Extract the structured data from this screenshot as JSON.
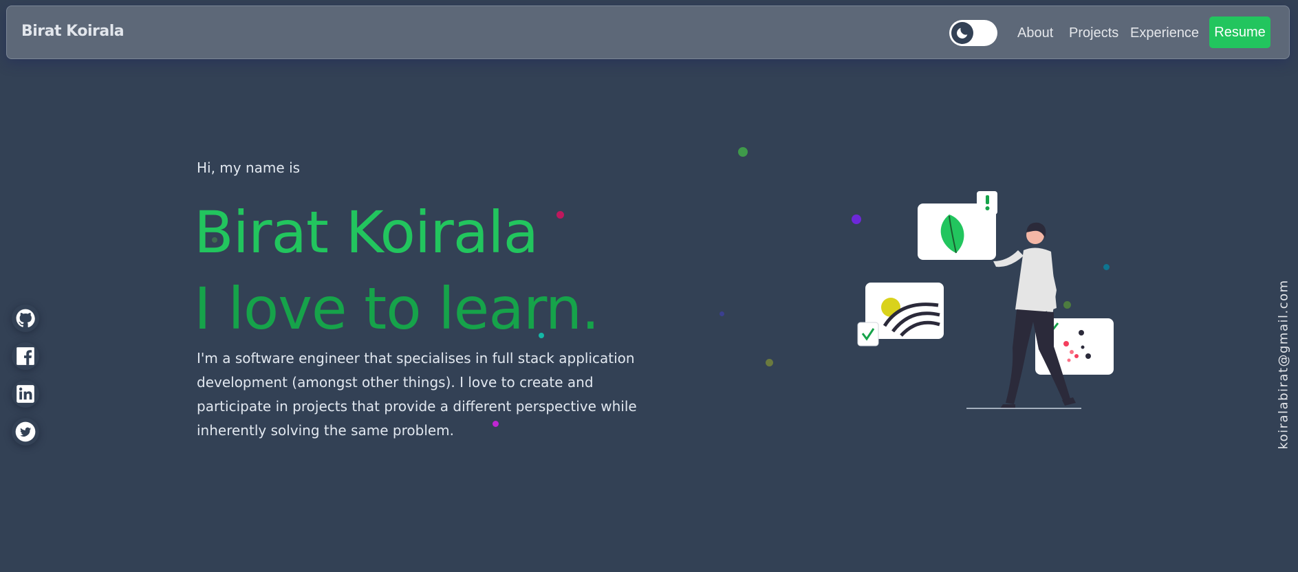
{
  "navbar": {
    "brand": "Birat Koirala",
    "links": [
      "About",
      "Projects",
      "Experience"
    ],
    "resume_label": "Resume",
    "theme_icon": "moon-icon"
  },
  "hero": {
    "greeting": "Hi, my name is",
    "name": "Birat Koirala",
    "tagline": "I love to learn.",
    "bio": "I'm a software engineer that specialises in full stack application development (amongst other things). I love to create and participate in projects that provide a different perspective while inherently solving the same problem."
  },
  "social": {
    "icons": [
      "github-icon",
      "facebook-icon",
      "linkedin-icon",
      "twitter-icon"
    ]
  },
  "email": "koiralabirat@gmail.com",
  "colors": {
    "background": "#334155",
    "navbar": "#5d6878",
    "accent": "#22c55e",
    "tagline": "#16a34a",
    "text": "#e2e8f0"
  }
}
